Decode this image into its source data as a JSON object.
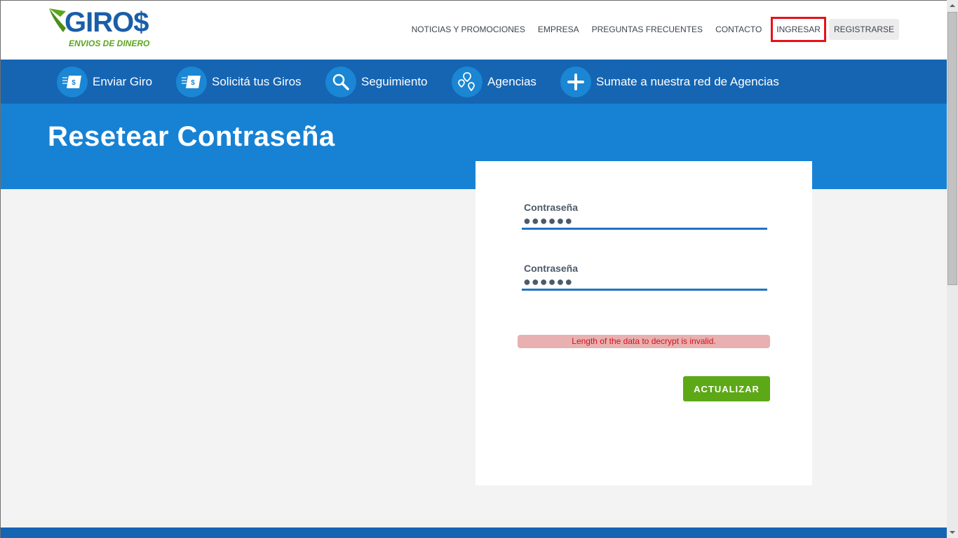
{
  "brand": {
    "name": "GIRO$",
    "tagline": "ENVIOS DE DINERO",
    "primary_color": "#1565b3",
    "accent_green": "#5da817"
  },
  "top_nav": {
    "items": [
      {
        "label": "NOTICIAS Y PROMOCIONES"
      },
      {
        "label": "EMPRESA"
      },
      {
        "label": "PREGUNTAS FRECUENTES"
      },
      {
        "label": "CONTACTO"
      },
      {
        "label": "INGRESAR",
        "highlighted": true
      },
      {
        "label": "REGISTRARSE"
      }
    ]
  },
  "service_nav": {
    "items": [
      {
        "label": "Enviar Giro",
        "icon": "money-transfer-icon"
      },
      {
        "label": "Solicitá tus Giros",
        "icon": "money-request-icon"
      },
      {
        "label": "Seguimiento",
        "icon": "search-icon"
      },
      {
        "label": "Agencias",
        "icon": "map-pins-icon"
      },
      {
        "label": "Sumate a nuestra red de Agencias",
        "icon": "plus-icon"
      }
    ]
  },
  "page": {
    "title": "Resetear Contraseña"
  },
  "form": {
    "password_label": "Contraseña",
    "password_value": "●●●●●●",
    "confirm_label": "Contraseña",
    "confirm_value": "●●●●●●",
    "error_message": "Length of the data to decrypt is invalid.",
    "submit_label": "ACTUALIZAR"
  }
}
